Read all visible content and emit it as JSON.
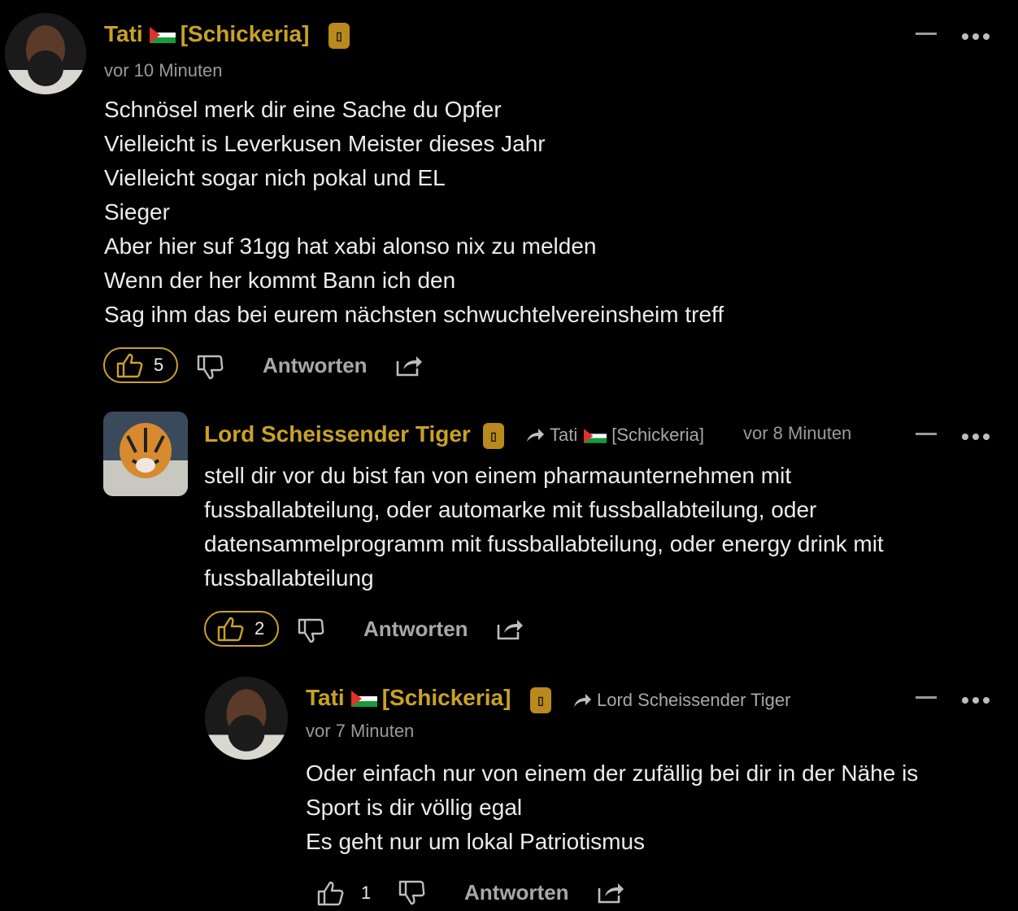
{
  "colors": {
    "accent": "#c9a227",
    "background": "#000000",
    "text": "#ececec",
    "muted": "#9a9a9a"
  },
  "comments": [
    {
      "user": "Tati",
      "group": "[Schickeria]",
      "time": "vor 10 Minuten",
      "lines": [
        "Schnösel merk dir eine Sache du Opfer",
        "Vielleicht is Leverkusen Meister dieses Jahr",
        "Vielleicht sogar nich pokal und EL",
        "Sieger",
        "Aber hier suf 31gg hat xabi alonso nix zu melden",
        "Wenn der her kommt Bann ich den",
        "Sag ihm das bei eurem nächsten schwuchtelvereinsheim treff"
      ],
      "likes": "5",
      "reply_label": "Antworten"
    },
    {
      "user": "Lord Scheissender Tiger",
      "reply_to_user": "Tati",
      "reply_to_group": "[Schickeria]",
      "time": "vor 8 Minuten",
      "lines": [
        "stell dir vor du bist fan von einem pharmaunternehmen mit",
        "fussballabteilung, oder automarke mit fussballabteilung, oder",
        "datensammelprogramm mit fussballabteilung, oder energy drink mit",
        "fussballabteilung"
      ],
      "likes": "2",
      "reply_label": "Antworten"
    },
    {
      "user": "Tati",
      "group": "[Schickeria]",
      "reply_to": "Lord Scheissender Tiger",
      "time": "vor 7 Minuten",
      "lines": [
        "Oder einfach nur von einem der zufällig bei dir in der Nähe is",
        "Sport is dir völlig egal",
        "Es geht nur um lokal Patriotismus"
      ],
      "likes": "1",
      "reply_label": "Antworten"
    }
  ]
}
